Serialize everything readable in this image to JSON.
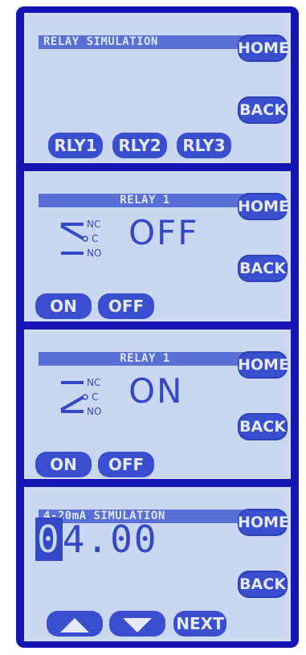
{
  "colors": {
    "frame": "#1515b4",
    "screen": "#c9d7f2",
    "button": "#3a4fd0",
    "text": "#3448c8"
  },
  "screens": [
    {
      "title": "RELAY SIMULATION",
      "home": "HOME",
      "back": "BACK",
      "buttons": [
        "RLY1",
        "RLY2",
        "RLY3"
      ]
    },
    {
      "title": "RELAY 1",
      "home": "HOME",
      "back": "BACK",
      "contacts": {
        "nc": "NC",
        "c": "C",
        "no": "NO"
      },
      "state": "OFF",
      "buttons": [
        "ON",
        "OFF"
      ]
    },
    {
      "title": "RELAY 1",
      "home": "HOME",
      "back": "BACK",
      "contacts": {
        "nc": "NC",
        "c": "C",
        "no": "NO"
      },
      "state": "ON",
      "buttons": [
        "ON",
        "OFF"
      ]
    },
    {
      "title": "4-20mA SIMULATION",
      "home": "HOME",
      "back": "BACK",
      "value_selected_digit": "0",
      "value_rest": "4.00",
      "buttons": {
        "up": "up-arrow-icon",
        "down": "down-arrow-icon",
        "next": "NEXT"
      }
    }
  ]
}
